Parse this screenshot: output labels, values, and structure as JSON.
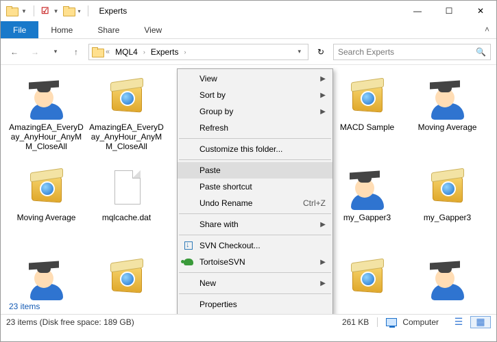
{
  "window": {
    "title": "Experts"
  },
  "ribbon": {
    "file": "File",
    "tabs": [
      "Home",
      "Share",
      "View"
    ]
  },
  "nav": {
    "crumbs": [
      "MQL4",
      "Experts"
    ],
    "search_placeholder": "Search Experts"
  },
  "items": [
    {
      "name": "AmazingEA_EveryDay_AnyHour_AnyMM_CloseAll",
      "icon": "expert"
    },
    {
      "name": "AmazingEA_EveryDay_AnyHour_AnyMM_CloseAll",
      "icon": "box"
    },
    {
      "name": "",
      "icon": ""
    },
    {
      "name": "",
      "icon": ""
    },
    {
      "name": "MACD Sample",
      "icon": "box"
    },
    {
      "name": "Moving Average",
      "icon": "expert"
    },
    {
      "name": "Moving Average",
      "icon": "box"
    },
    {
      "name": "mqlcache.dat",
      "icon": "doc"
    },
    {
      "name": "",
      "icon": ""
    },
    {
      "name": "",
      "icon": ""
    },
    {
      "name": "my_Gapper3",
      "icon": "expert"
    },
    {
      "name": "my_Gapper3",
      "icon": "box"
    },
    {
      "name": "",
      "icon": "expert"
    },
    {
      "name": "",
      "icon": "box"
    },
    {
      "name": "",
      "icon": ""
    },
    {
      "name": "",
      "icon": ""
    },
    {
      "name": "",
      "icon": "box"
    },
    {
      "name": "",
      "icon": "expert"
    }
  ],
  "context_menu": {
    "view": "View",
    "sort_by": "Sort by",
    "group_by": "Group by",
    "refresh": "Refresh",
    "customize": "Customize this folder...",
    "paste": "Paste",
    "paste_shortcut": "Paste shortcut",
    "undo_rename": "Undo Rename",
    "undo_shortcut": "Ctrl+Z",
    "share_with": "Share with",
    "svn_checkout": "SVN Checkout...",
    "tortoisesvn": "TortoiseSVN",
    "new": "New",
    "properties": "Properties"
  },
  "count_label": "23 items",
  "status": {
    "left": "23 items (Disk free space: 189 GB)",
    "size": "261 KB",
    "location": "Computer"
  }
}
